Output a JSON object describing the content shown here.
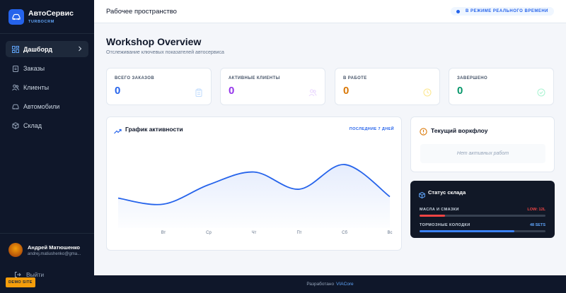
{
  "brand": {
    "name": "АвтоСервис",
    "subtitle": "TURBOCRM"
  },
  "sidebar": {
    "items": [
      {
        "label": "Дашборд",
        "icon": "dashboard-icon",
        "active": true
      },
      {
        "label": "Заказы",
        "icon": "clipboard-icon"
      },
      {
        "label": "Клиенты",
        "icon": "users-icon"
      },
      {
        "label": "Автомобили",
        "icon": "car-icon"
      },
      {
        "label": "Склад",
        "icon": "box-icon"
      }
    ],
    "user": {
      "name": "Андрей Матюшенко",
      "email": "andrej.matiushenko@gma..."
    },
    "logout_label": "Выйти",
    "demo_badge": "DEMO SITE"
  },
  "header": {
    "title": "Рабочее пространство",
    "live_label": "В РЕЖИМЕ РЕАЛЬНОГО ВРЕМЕНИ"
  },
  "main": {
    "title": "Workshop Overview",
    "subtitle": "Отслеживание ключевых показателей автосервиса",
    "stats": [
      {
        "label": "ВСЕГО ЗАКАЗОВ",
        "value": "0",
        "color": "#2563eb",
        "icon": "clipboard-icon"
      },
      {
        "label": "АКТИВНЫЕ КЛИЕНТЫ",
        "value": "0",
        "color": "#9333ea",
        "icon": "users-icon"
      },
      {
        "label": "В РАБОТЕ",
        "value": "0",
        "color": "#d97706",
        "icon": "clock-icon"
      },
      {
        "label": "ЗАВЕРШЕНО",
        "value": "0",
        "color": "#059669",
        "icon": "check-circle-icon"
      }
    ]
  },
  "activity": {
    "title": "График активности",
    "period": "ПОСЛЕДНИЕ 7 ДНЕЙ"
  },
  "chart_data": {
    "type": "area",
    "categories": [
      "",
      "Вт",
      "Ср",
      "Чт",
      "Пт",
      "Сб",
      "Вс"
    ],
    "values": [
      40,
      32,
      58,
      75,
      52,
      85,
      42
    ],
    "ylim": [
      0,
      120
    ],
    "color": "#2563eb",
    "grid": false
  },
  "workflow": {
    "title": "Текущий воркфлоу",
    "empty": "Нет активных работ"
  },
  "stock": {
    "title": "Статус склада",
    "rows": [
      {
        "label": "МАСЛА И СМАЗКИ",
        "status": "LOW: 12L",
        "level": 0.2,
        "color": "#ef4444"
      },
      {
        "label": "ТОРМОЗНЫЕ КОЛОДКИ",
        "status": "48 SETS",
        "level": 0.75,
        "color": "#3b82f6"
      }
    ]
  },
  "footer": {
    "text": "Разработано",
    "link": "VIACore"
  }
}
